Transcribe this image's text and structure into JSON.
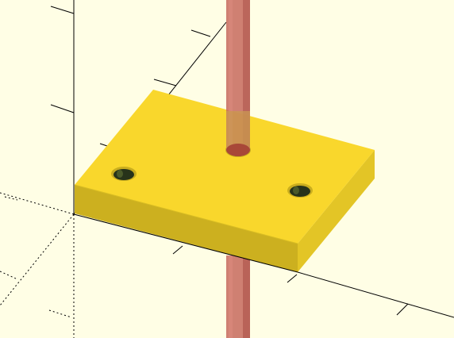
{
  "viewport": {
    "background": "#fffee5",
    "axis_color": "#000000",
    "part_colors": {
      "plate_top": "#f9d72c",
      "plate_front": "#ccb01f",
      "plate_side": "#e3c526",
      "hole": "#27331a",
      "rod": "#c0505080"
    },
    "objects": [
      "rectangular-plate",
      "mounting-hole-left",
      "mounting-hole-right",
      "center-rod-hole",
      "transparent-rod"
    ]
  }
}
